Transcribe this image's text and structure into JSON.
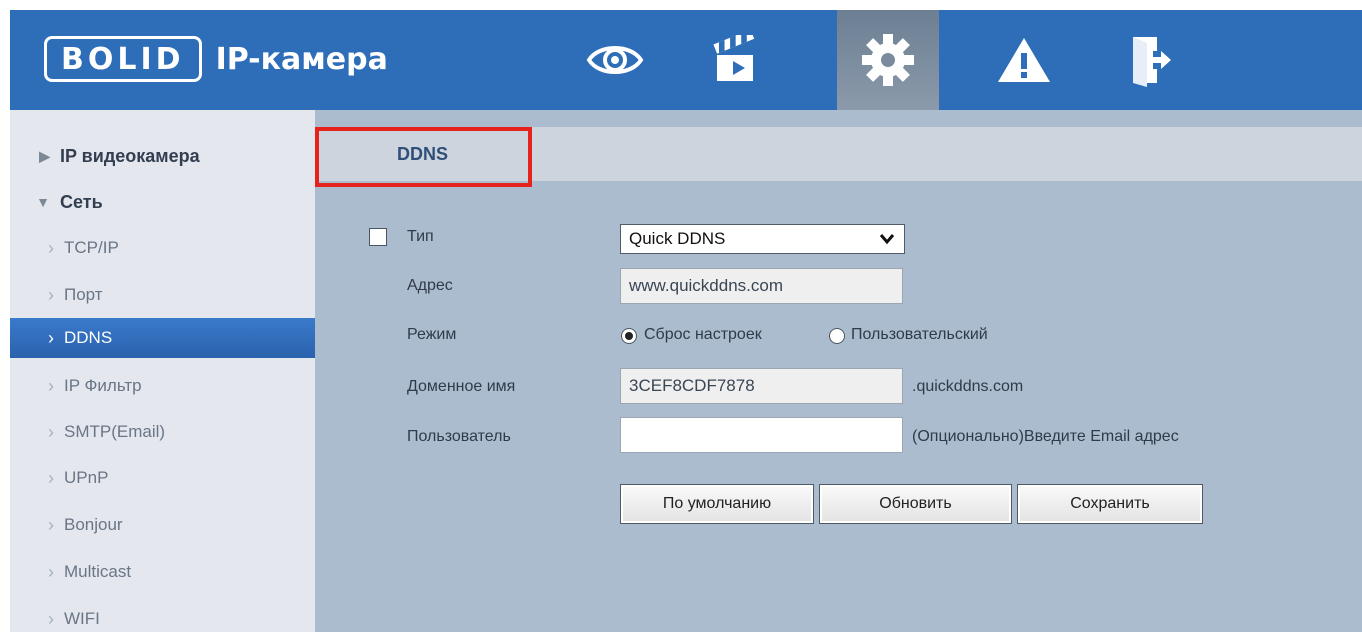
{
  "header": {
    "logo": "BOLID",
    "title": "IP-камера",
    "icons": [
      "eye-icon",
      "clapperboard-icon",
      "gear-icon",
      "warning-icon",
      "logout-icon"
    ],
    "active_icon": "gear-icon",
    "colors": {
      "bar": "#2e6db7",
      "active": "#7b8b9d"
    }
  },
  "sidebar": {
    "items": [
      {
        "label": "IP видеокамера",
        "arrow": "▶",
        "level": "top"
      },
      {
        "label": "Сеть",
        "arrow": "▼",
        "level": "top"
      },
      {
        "label": "TCP/IP",
        "arrow": "›",
        "level": "sub"
      },
      {
        "label": "Порт",
        "arrow": "›",
        "level": "sub"
      },
      {
        "label": "DDNS",
        "arrow": "›",
        "level": "sub",
        "selected": true
      },
      {
        "label": "IP Фильтр",
        "arrow": "›",
        "level": "sub"
      },
      {
        "label": "SMTP(Email)",
        "arrow": "›",
        "level": "sub"
      },
      {
        "label": "UPnP",
        "arrow": "›",
        "level": "sub"
      },
      {
        "label": "Bonjour",
        "arrow": "›",
        "level": "sub"
      },
      {
        "label": "Multicast",
        "arrow": "›",
        "level": "sub"
      },
      {
        "label": "WIFI",
        "arrow": "›",
        "level": "sub"
      }
    ]
  },
  "main": {
    "tab": "DDNS",
    "form": {
      "type_label": "Тип",
      "type_checked": false,
      "type_value": "Quick DDNS",
      "address_label": "Адрес",
      "address_value": "www.quickddns.com",
      "mode_label": "Режим",
      "mode_options": [
        "Сброс настроек",
        "Пользовательский"
      ],
      "mode_selected": "Сброс настроек",
      "domain_label": "Доменное имя",
      "domain_value": "3CEF8CDF7878",
      "domain_suffix": ".quickddns.com",
      "user_label": "Пользователь",
      "user_value": "",
      "user_hint": "(Опционально)Введите Email адрес"
    },
    "buttons": {
      "default": "По умолчанию",
      "refresh": "Обновить",
      "save": "Сохранить"
    }
  }
}
